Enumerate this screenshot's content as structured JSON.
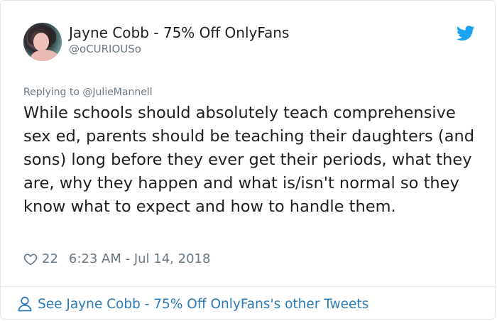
{
  "author": {
    "display_name": "Jayne Cobb - 75% Off OnlyFans",
    "handle": "@oCURIOUSo"
  },
  "reply": {
    "prefix": "Replying to ",
    "mention": "@JulieMannell"
  },
  "tweet": {
    "text": "While schools should absolutely teach comprehensive sex ed, parents should be teaching their daughters (and sons) long before they ever get their periods, what they are, why they happen and what is/isn't normal so they know what to expect and how to handle them.",
    "likes": "22",
    "timestamp": "6:23 AM - Jul 14, 2018"
  },
  "footer": {
    "link_text": "See Jayne Cobb - 75% Off OnlyFans's other Tweets"
  },
  "icons": {
    "brand": "twitter-bird-icon",
    "like": "heart-icon",
    "profile": "person-icon"
  },
  "colors": {
    "brand_blue": "#1da1f2",
    "link_blue": "#2b7bb9",
    "muted_gray": "#697882",
    "text": "#1c2022",
    "border": "#e1e8ed"
  }
}
